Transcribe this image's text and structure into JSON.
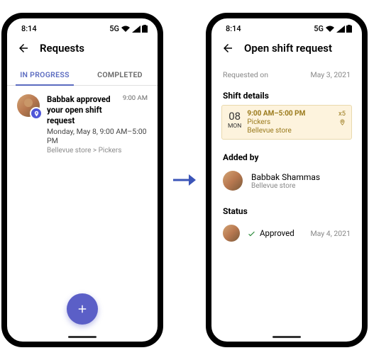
{
  "status_bar": {
    "time": "8:14",
    "network": "5G"
  },
  "left": {
    "title": "Requests",
    "tabs": {
      "in_progress": "IN PROGRESS",
      "completed": "COMPLETED"
    },
    "request": {
      "title": "Babbak approved your open shift request",
      "time": "9:00 AM",
      "subtitle": "Monday, May 8, 9:00 AM–5:00 PM",
      "breadcrumb": "Bellevue store > Pickers"
    }
  },
  "right": {
    "title": "Open shift request",
    "requested_on_label": "Requested on",
    "requested_on_date": "May 3, 2021",
    "shift_details_label": "Shift details",
    "shift": {
      "day_num": "08",
      "day_wk": "MON",
      "time": "9:00 AM–5:00 PM",
      "mult": "x5",
      "group": "Pickers",
      "store": "Bellevue store"
    },
    "added_by_label": "Added by",
    "added_by": {
      "name": "Babbak Shammas",
      "store": "Bellevue store"
    },
    "status_label": "Status",
    "status": {
      "text": "Approved",
      "date": "May 4, 2021"
    }
  }
}
